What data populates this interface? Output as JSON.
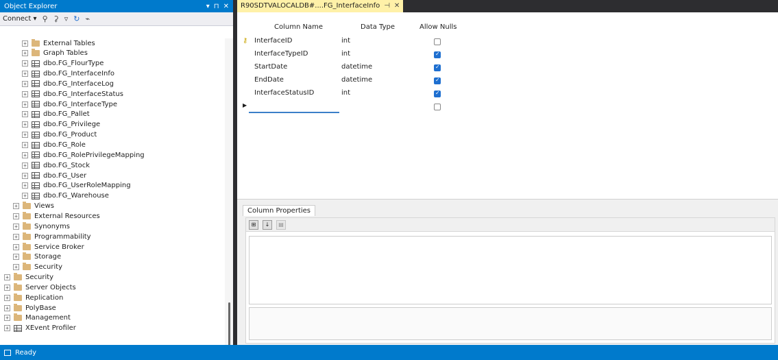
{
  "object_explorer": {
    "title": "Object Explorer",
    "controls": [
      "▾",
      "⊓",
      "✕"
    ],
    "toolbar": {
      "connect_label": "Connect",
      "icons": [
        "connect-icon",
        "disconnect-icon",
        "filter-icon",
        "refresh-icon",
        "activity-icon"
      ]
    },
    "tree": [
      {
        "label": "External Tables",
        "icon": "folder",
        "indent": 2,
        "expander": "+"
      },
      {
        "label": "Graph Tables",
        "icon": "folder",
        "indent": 2,
        "expander": "+"
      },
      {
        "label": "dbo.FG_FlourType",
        "icon": "table",
        "indent": 2,
        "expander": "+"
      },
      {
        "label": "dbo.FG_InterfaceInfo",
        "icon": "table",
        "indent": 2,
        "expander": "+"
      },
      {
        "label": "dbo.FG_InterfaceLog",
        "icon": "table",
        "indent": 2,
        "expander": "+"
      },
      {
        "label": "dbo.FG_InterfaceStatus",
        "icon": "table",
        "indent": 2,
        "expander": "+"
      },
      {
        "label": "dbo.FG_InterfaceType",
        "icon": "table",
        "indent": 2,
        "expander": "+"
      },
      {
        "label": "dbo.FG_Pallet",
        "icon": "table",
        "indent": 2,
        "expander": "+"
      },
      {
        "label": "dbo.FG_Privilege",
        "icon": "table",
        "indent": 2,
        "expander": "+"
      },
      {
        "label": "dbo.FG_Product",
        "icon": "table",
        "indent": 2,
        "expander": "+"
      },
      {
        "label": "dbo.FG_Role",
        "icon": "table",
        "indent": 2,
        "expander": "+"
      },
      {
        "label": "dbo.FG_RolePrivilegeMapping",
        "icon": "table",
        "indent": 2,
        "expander": "+"
      },
      {
        "label": "dbo.FG_Stock",
        "icon": "table",
        "indent": 2,
        "expander": "+"
      },
      {
        "label": "dbo.FG_User",
        "icon": "table",
        "indent": 2,
        "expander": "+"
      },
      {
        "label": "dbo.FG_UserRoleMapping",
        "icon": "table",
        "indent": 2,
        "expander": "+"
      },
      {
        "label": "dbo.FG_Warehouse",
        "icon": "table",
        "indent": 2,
        "expander": "+"
      },
      {
        "label": "Views",
        "icon": "folder",
        "indent": 1,
        "expander": "+"
      },
      {
        "label": "External Resources",
        "icon": "folder",
        "indent": 1,
        "expander": "+"
      },
      {
        "label": "Synonyms",
        "icon": "folder",
        "indent": 1,
        "expander": "+"
      },
      {
        "label": "Programmability",
        "icon": "folder",
        "indent": 1,
        "expander": "+"
      },
      {
        "label": "Service Broker",
        "icon": "folder",
        "indent": 1,
        "expander": "+"
      },
      {
        "label": "Storage",
        "icon": "folder",
        "indent": 1,
        "expander": "+"
      },
      {
        "label": "Security",
        "icon": "folder",
        "indent": 1,
        "expander": "+"
      },
      {
        "label": "Security",
        "icon": "folder",
        "indent": 0,
        "expander": "+"
      },
      {
        "label": "Server Objects",
        "icon": "folder",
        "indent": 0,
        "expander": "+"
      },
      {
        "label": "Replication",
        "icon": "folder",
        "indent": 0,
        "expander": "+"
      },
      {
        "label": "PolyBase",
        "icon": "folder",
        "indent": 0,
        "expander": "+"
      },
      {
        "label": "Management",
        "icon": "folder",
        "indent": 0,
        "expander": "+"
      },
      {
        "label": "XEvent Profiler",
        "icon": "table",
        "indent": 0,
        "expander": "+"
      }
    ]
  },
  "document": {
    "tab_title": "R90SDTVALOCALDB#....FG_InterfaceInfo",
    "pin_icon": "⊣",
    "close_icon": "✕",
    "headers": {
      "column_name": "Column Name",
      "data_type": "Data Type",
      "allow_nulls": "Allow Nulls"
    },
    "rows": [
      {
        "column_name": "InterfaceID",
        "data_type": "int",
        "allow_nulls": false,
        "primary_key": true
      },
      {
        "column_name": "InterfaceTypeID",
        "data_type": "int",
        "allow_nulls": true,
        "primary_key": false
      },
      {
        "column_name": "StartDate",
        "data_type": "datetime",
        "allow_nulls": true,
        "primary_key": false
      },
      {
        "column_name": "EndDate",
        "data_type": "datetime",
        "allow_nulls": true,
        "primary_key": false
      },
      {
        "column_name": "InterfaceStatusID",
        "data_type": "int",
        "allow_nulls": true,
        "primary_key": false
      }
    ],
    "new_row": {
      "column_name": "",
      "allow_nulls": false
    }
  },
  "column_properties": {
    "tab_label": "Column Properties",
    "toolbar_icons": [
      "categorized-icon",
      "alphabetical-icon",
      "property-pages-icon"
    ],
    "toolbar_glyphs": [
      "⊞",
      "↓",
      "▤"
    ]
  },
  "status_bar": {
    "text": "Ready"
  },
  "colors": {
    "accent": "#007acc",
    "tab_active": "#fff1a8",
    "checkbox_on": "#1e6fd0",
    "folder": "#dcb67a"
  }
}
